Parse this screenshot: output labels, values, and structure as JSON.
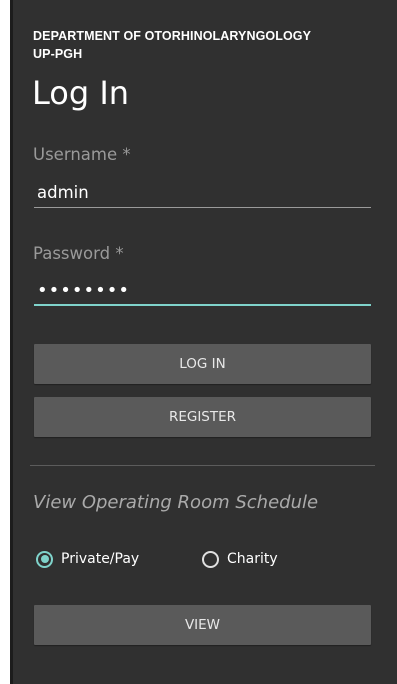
{
  "header": {
    "department": "DEPARTMENT OF OTORHINOLARYNGOLOGY",
    "institution": "UP-PGH",
    "title": "Log In"
  },
  "form": {
    "username_label": "Username *",
    "username_value": "admin",
    "password_label": "Password *",
    "password_value": "••••••••"
  },
  "buttons": {
    "login": "LOG IN",
    "register": "REGISTER",
    "view": "VIEW"
  },
  "schedule": {
    "title": "View Operating Room Schedule",
    "options": [
      {
        "label": "Private/Pay",
        "selected": true
      },
      {
        "label": "Charity",
        "selected": false
      }
    ]
  },
  "colors": {
    "background": "#303030",
    "accent": "#7fd3cb",
    "button": "#5a5a5a"
  }
}
